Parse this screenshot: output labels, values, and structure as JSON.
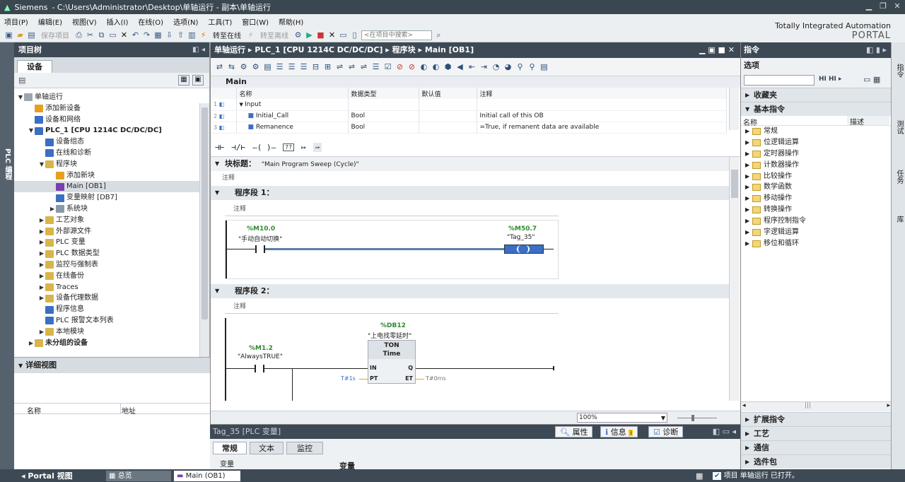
{
  "titlebar": {
    "app": "Siemens",
    "path": "-   C:\\Users\\Administrator\\Desktop\\单轴运行 - 副本\\单轴运行",
    "win_min": "▁",
    "win_max": "❐",
    "win_close": "✕"
  },
  "menu": [
    "项目(P)",
    "编辑(E)",
    "视图(V)",
    "插入(I)",
    "在线(O)",
    "选项(N)",
    "工具(T)",
    "窗口(W)",
    "帮助(H)"
  ],
  "toolbar": {
    "save_project": "保存项目",
    "go_online": "转至在线",
    "go_offline": "转至离线",
    "search_placeholder": "<在项目中搜索>"
  },
  "brand": {
    "line1": "Totally Integrated Automation",
    "line2": "PORTAL"
  },
  "left_tab": "PLC 编程",
  "project_tree": {
    "title": "项目树",
    "tab": "设备",
    "items": [
      {
        "label": "单轴运行",
        "indent": 0,
        "arrow": "▼",
        "icon": "doc"
      },
      {
        "label": "添加新设备",
        "indent": 1,
        "arrow": "",
        "icon": "add"
      },
      {
        "label": "设备和网络",
        "indent": 1,
        "arrow": "",
        "icon": "net"
      },
      {
        "label": "PLC_1 [CPU 1214C DC/DC/DC]",
        "indent": 1,
        "arrow": "▼",
        "icon": "plc",
        "bold": true
      },
      {
        "label": "设备组态",
        "indent": 2,
        "arrow": "",
        "icon": "cfg"
      },
      {
        "label": "在线和诊断",
        "indent": 2,
        "arrow": "",
        "icon": "diag"
      },
      {
        "label": "程序块",
        "indent": 2,
        "arrow": "▼",
        "icon": "folder"
      },
      {
        "label": "添加新块",
        "indent": 3,
        "arrow": "",
        "icon": "add"
      },
      {
        "label": "Main [OB1]",
        "indent": 3,
        "arrow": "",
        "icon": "ob",
        "selected": true
      },
      {
        "label": "变量映射 [DB7]",
        "indent": 3,
        "arrow": "",
        "icon": "db"
      },
      {
        "label": "系统块",
        "indent": 3,
        "arrow": "▶",
        "icon": "sys"
      },
      {
        "label": "工艺对象",
        "indent": 2,
        "arrow": "▶",
        "icon": "folder"
      },
      {
        "label": "外部源文件",
        "indent": 2,
        "arrow": "▶",
        "icon": "folder"
      },
      {
        "label": "PLC 变量",
        "indent": 2,
        "arrow": "▶",
        "icon": "folder"
      },
      {
        "label": "PLC 数据类型",
        "indent": 2,
        "arrow": "▶",
        "icon": "folder"
      },
      {
        "label": "监控与强制表",
        "indent": 2,
        "arrow": "▶",
        "icon": "folder"
      },
      {
        "label": "在线备份",
        "indent": 2,
        "arrow": "▶",
        "icon": "folder"
      },
      {
        "label": "Traces",
        "indent": 2,
        "arrow": "▶",
        "icon": "folder"
      },
      {
        "label": "设备代理数据",
        "indent": 2,
        "arrow": "▶",
        "icon": "folder"
      },
      {
        "label": "程序信息",
        "indent": 2,
        "arrow": "",
        "icon": "info"
      },
      {
        "label": "PLC 报警文本列表",
        "indent": 2,
        "arrow": "",
        "icon": "list"
      },
      {
        "label": "本地模块",
        "indent": 2,
        "arrow": "▶",
        "icon": "folder"
      },
      {
        "label": "未分组的设备",
        "indent": 1,
        "arrow": "▶",
        "icon": "folder",
        "bold": true
      }
    ]
  },
  "detail_view": {
    "title": "详细视图",
    "col_name": "名称",
    "col_address": "地址"
  },
  "editor": {
    "breadcrumb": [
      "单轴运行",
      "PLC_1 [CPU 1214C DC/DC/DC]",
      "程序块",
      "Main [OB1]"
    ],
    "interface": {
      "title": "Main",
      "headers": [
        "名称",
        "数据类型",
        "默认值",
        "注释"
      ],
      "rows": [
        {
          "num": "1",
          "name": "Input",
          "type": "",
          "default": "",
          "comment": ""
        },
        {
          "num": "2",
          "name": "Initial_Call",
          "type": "Bool",
          "default": "",
          "comment": "Initial call of this OB"
        },
        {
          "num": "3",
          "name": "Remanence",
          "type": "Bool",
          "default": "",
          "comment": "=True, if remanent data are available"
        }
      ]
    },
    "ladder_tools": [
      "⊣⊢",
      "⊣/⊢",
      "–( )–",
      "??",
      "↦",
      "⇀"
    ],
    "block_title_label": "块标题：",
    "block_title": "\"Main Program Sweep (Cycle)\"",
    "comment_label": "注释",
    "networks": [
      {
        "label": "程序段 1：",
        "comment": "注释",
        "contact": {
          "addr": "%M10.0",
          "name": "\"手动自动切换\""
        },
        "coil": {
          "addr": "%M50.7",
          "name": "\"Tag_35\""
        }
      },
      {
        "label": "程序段 2：",
        "comment": "注释",
        "contact": {
          "addr": "%M1.2",
          "name": "\"AlwaysTRUE\""
        },
        "timer": {
          "addr": "%DB12",
          "name": "\"上电找零延时\"",
          "type": "TON",
          "subtype": "Time",
          "in": "IN",
          "pt": "PT",
          "q": "Q",
          "et": "ET",
          "pt_value": "T#1s",
          "et_value": "T#0ms"
        }
      }
    ],
    "zoom": "100%"
  },
  "properties": {
    "object": "Tag_35 [PLC 变量]",
    "btn_props": "属性",
    "btn_info": "信息",
    "btn_diag": "诊断",
    "tabs": [
      "常规",
      "文本",
      "监控"
    ],
    "left_label": "变量",
    "right_label": "变量"
  },
  "instructions": {
    "title": "指令",
    "options": "选项",
    "favorites": "收藏夹",
    "basic": "基本指令",
    "col_name": "名称",
    "col_desc": "描述",
    "items": [
      "常规",
      "位逻辑运算",
      "定时器操作",
      "计数器操作",
      "比较操作",
      "数学函数",
      "移动操作",
      "转换操作",
      "程序控制指令",
      "字逻辑运算",
      "移位和循环"
    ],
    "sections": [
      "扩展指令",
      "工艺",
      "通信",
      "选件包"
    ]
  },
  "right_tabs": [
    "指令",
    "测试",
    "任务",
    "库"
  ],
  "statusbar": {
    "portal": "Portal 视图",
    "overview": "总览",
    "main_tab": "Main (OB1)",
    "status": "项目 单轴运行 已打开。"
  },
  "colors": {
    "accent": "#3d4a55",
    "coil": "#3a6fc4",
    "contact_addr": "#2e8b2e",
    "selection": "#d8dde2"
  }
}
